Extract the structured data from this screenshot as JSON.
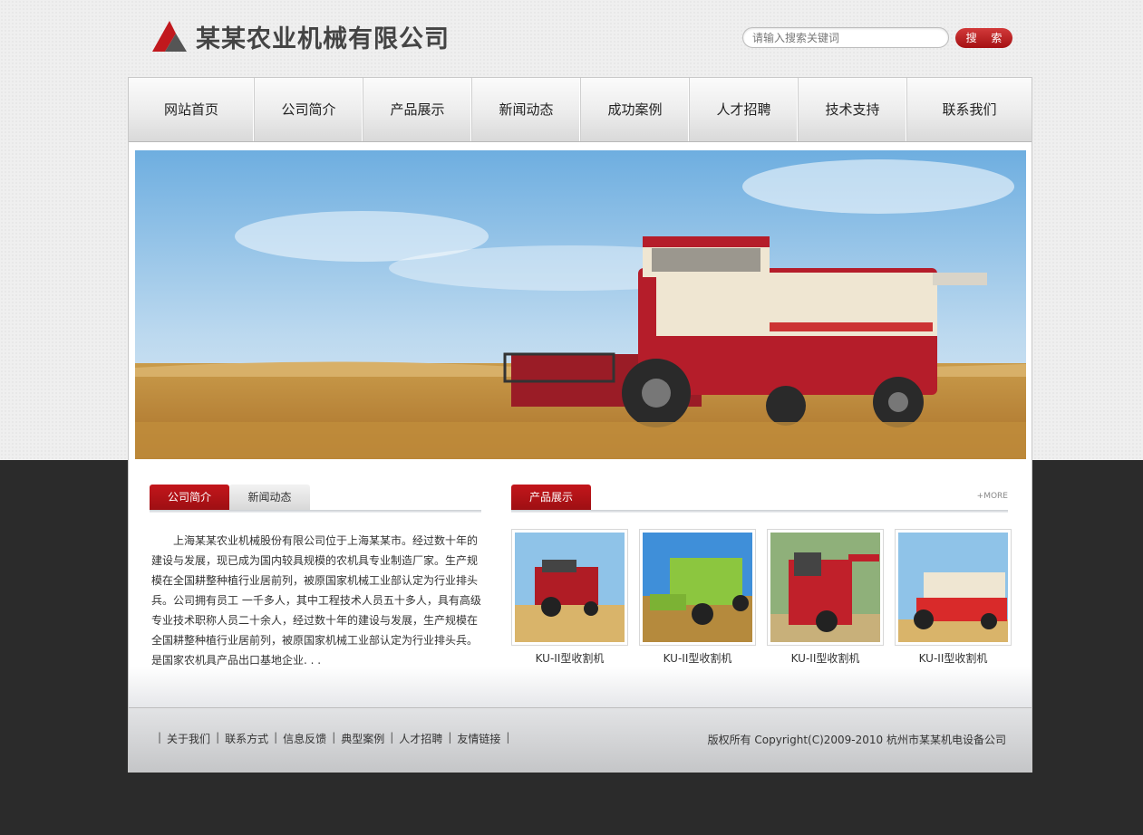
{
  "header": {
    "company_name": "某某农业机械有限公司",
    "search_placeholder": "请输入搜索关键词",
    "search_button": "搜 索"
  },
  "nav": [
    {
      "label": "网站首页"
    },
    {
      "label": "公司简介"
    },
    {
      "label": "产品展示"
    },
    {
      "label": "新闻动态"
    },
    {
      "label": "成功案例"
    },
    {
      "label": "人才招聘"
    },
    {
      "label": "技术支持"
    },
    {
      "label": "联系我们"
    }
  ],
  "intro": {
    "tab_active": "公司简介",
    "tab_inactive": "新闻动态",
    "text": "上海某某农业机械股份有限公司位于上海某某市。经过数十年的建设与发展，现已成为国内较具规模的农机具专业制造厂家。生产规模在全国耕整种植行业居前列，被原国家机械工业部认定为行业排头兵。公司拥有员工 一千多人，其中工程技术人员五十多人，具有高级专业技术职称人员二十余人，经过数十年的建设与发展，生产规模在全国耕整种植行业居前列，被原国家机械工业部认定为行业排头兵。是国家农机具产品出口基地企业. . ."
  },
  "products_section": {
    "tab": "产品展示",
    "more": "+MORE",
    "items": [
      {
        "caption": "KU-II型收割机",
        "color": "#b01c25"
      },
      {
        "caption": "KU-II型收割机",
        "color": "#8cc63f"
      },
      {
        "caption": "KU-II型收割机",
        "color": "#c0202a"
      },
      {
        "caption": "KU-II型收割机",
        "color": "#d92a2a"
      }
    ]
  },
  "footer": {
    "links": [
      "关于我们",
      "联系方式",
      "信息反馈",
      "典型案例",
      "人才招聘",
      "友情链接"
    ],
    "copyright": "版权所有 Copyright(C)2009-2010 杭州市某某机电设备公司"
  },
  "colors": {
    "accent": "#a8141a",
    "dark_bg": "#2b2b2b"
  }
}
